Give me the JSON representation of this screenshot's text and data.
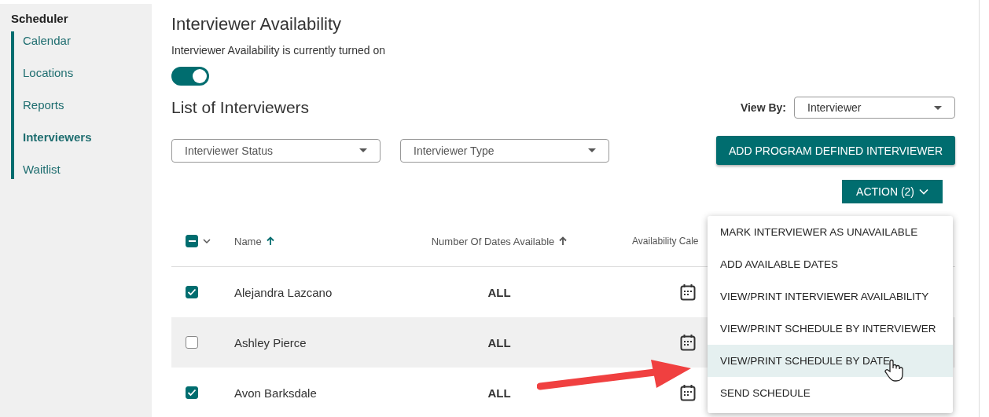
{
  "sidebar": {
    "title": "Scheduler",
    "items": [
      {
        "label": "Calendar",
        "selected": false
      },
      {
        "label": "Locations",
        "selected": false
      },
      {
        "label": "Reports",
        "selected": false
      },
      {
        "label": "Interviewers",
        "selected": true
      },
      {
        "label": "Waitlist",
        "selected": false
      }
    ]
  },
  "page": {
    "title": "Interviewer Availability",
    "status_text": "Interviewer Availability is currently turned on",
    "availability_toggle": {
      "on": true
    }
  },
  "list": {
    "title": "List of Interviewers",
    "view_by": {
      "label": "View By:",
      "value": "Interviewer"
    },
    "filters": [
      {
        "placeholder": "Interviewer Status"
      },
      {
        "placeholder": "Interviewer Type"
      }
    ],
    "add_button": "ADD PROGRAM DEFINED INTERVIEWER",
    "action_button": "ACTION (2)"
  },
  "table": {
    "select_all": {
      "partial": true
    },
    "columns": [
      {
        "label": "Name",
        "sort_active": true
      },
      {
        "label": "Number Of Dates Available",
        "sort_active": false
      },
      {
        "label": "Availability Cale"
      }
    ],
    "rows": [
      {
        "checked": true,
        "name": "Alejandra Lazcano",
        "dates": "ALL",
        "hovered": false
      },
      {
        "checked": false,
        "name": "Ashley Pierce",
        "dates": "ALL",
        "hovered": true
      },
      {
        "checked": true,
        "name": "Avon Barksdale",
        "dates": "ALL",
        "hovered": false
      }
    ]
  },
  "action_menu": {
    "items": [
      {
        "label": "MARK INTERVIEWER AS UNAVAILABLE",
        "highlighted": false
      },
      {
        "label": "ADD AVAILABLE DATES",
        "highlighted": false
      },
      {
        "label": "VIEW/PRINT INTERVIEWER AVAILABILITY",
        "highlighted": false
      },
      {
        "label": "VIEW/PRINT SCHEDULE BY INTERVIEWER",
        "highlighted": false
      },
      {
        "label": "VIEW/PRINT SCHEDULE BY DATE",
        "highlighted": true
      },
      {
        "label": "SEND SCHEDULE",
        "highlighted": false
      }
    ]
  }
}
